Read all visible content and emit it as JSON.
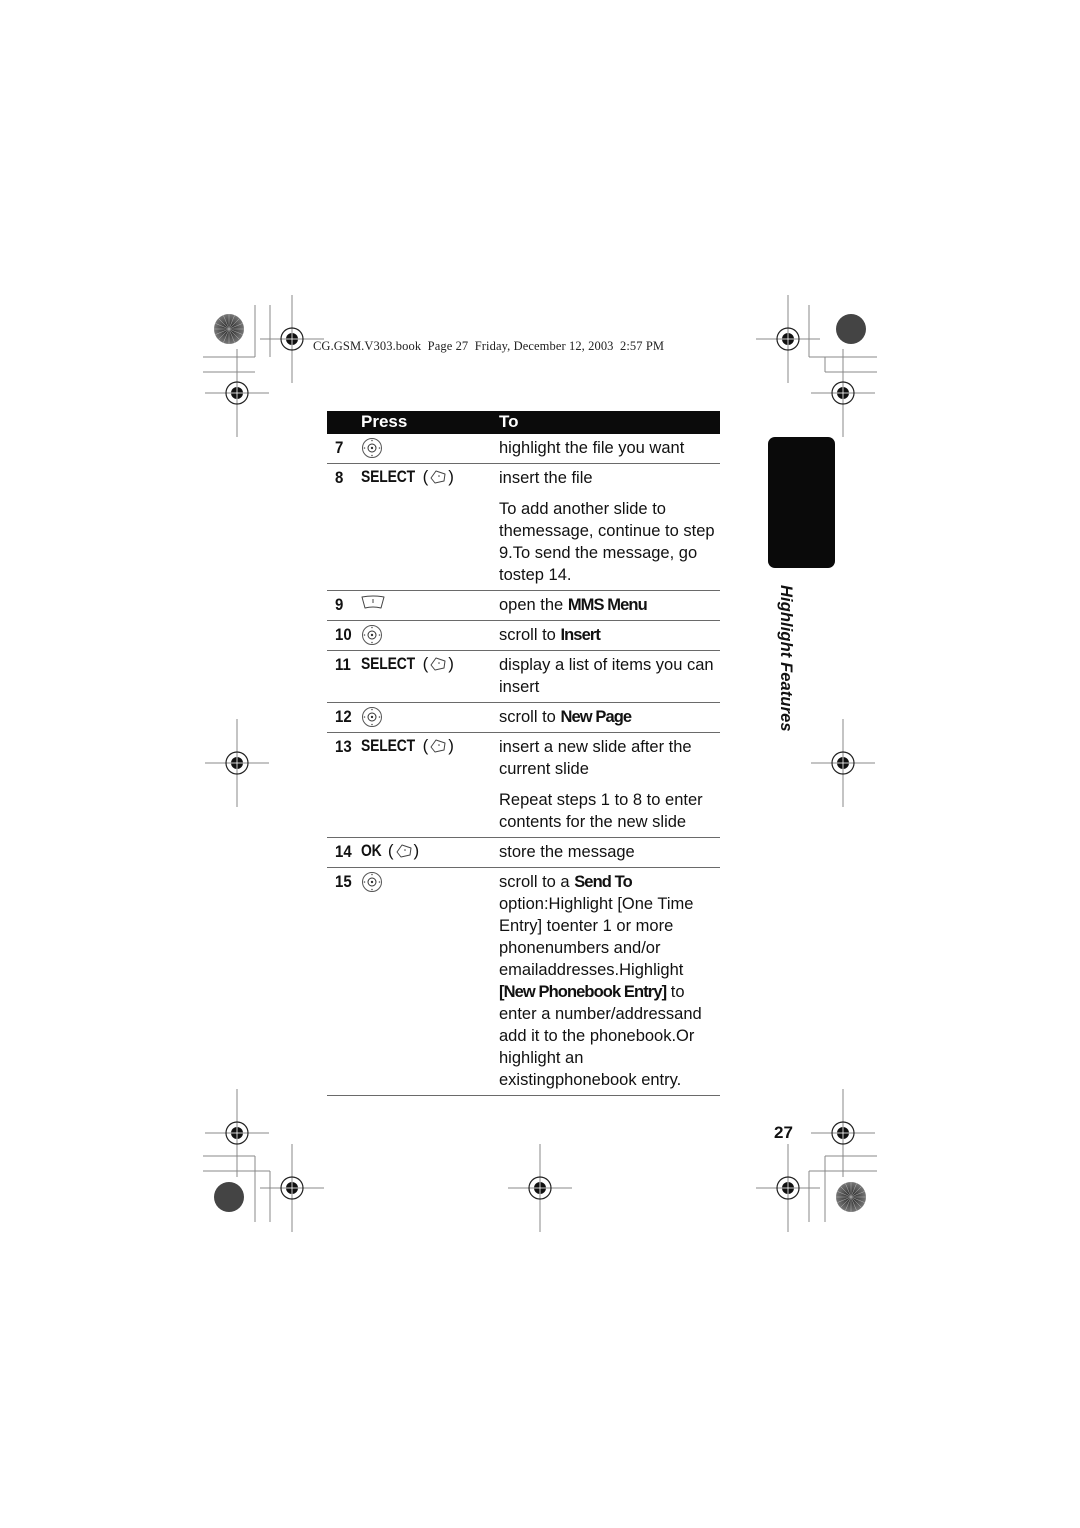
{
  "header": {
    "running_head": "CG.GSM.V303.book  Page 27  Friday, December 12, 2003  2:57 PM"
  },
  "table": {
    "columns": [
      "Press",
      "To"
    ],
    "rows": [
      {
        "step": "7",
        "press_label": "",
        "press_icon": "nav-key-icon",
        "to": [
          {
            "parts": [
              {
                "t": "highlight the file you want"
              }
            ]
          }
        ]
      },
      {
        "step": "8",
        "press_label": "SELECT",
        "press_icon": "right-soft-key-icon",
        "to": [
          {
            "parts": [
              {
                "t": "insert the file"
              }
            ]
          },
          {
            "parts": [
              {
                "t": "To add another slide to themessage, continue to step 9.To send the message, go tostep 14."
              }
            ]
          }
        ]
      },
      {
        "step": "9",
        "press_label": "",
        "press_icon": "menu-key-icon",
        "to": [
          {
            "parts": [
              {
                "t": "open the "
              },
              {
                "t": "MMS Menu",
                "kw": true
              }
            ]
          }
        ]
      },
      {
        "step": "10",
        "press_label": "",
        "press_icon": "nav-key-icon",
        "to": [
          {
            "parts": [
              {
                "t": "scroll to "
              },
              {
                "t": "Insert",
                "kw": true
              }
            ]
          }
        ]
      },
      {
        "step": "11",
        "press_label": "SELECT",
        "press_icon": "right-soft-key-icon",
        "to": [
          {
            "parts": [
              {
                "t": "display a list of items you can insert"
              }
            ]
          }
        ]
      },
      {
        "step": "12",
        "press_label": "",
        "press_icon": "nav-key-icon",
        "to": [
          {
            "parts": [
              {
                "t": "scroll to "
              },
              {
                "t": "New Page",
                "kw": true
              }
            ]
          }
        ]
      },
      {
        "step": "13",
        "press_label": "SELECT",
        "press_icon": "right-soft-key-icon",
        "to": [
          {
            "parts": [
              {
                "t": "insert a new slide after the current slide"
              }
            ]
          },
          {
            "parts": [
              {
                "t": "Repeat steps 1 to 8 to enter contents for the new slide"
              }
            ]
          }
        ]
      },
      {
        "step": "14",
        "press_label": "OK",
        "press_icon": "right-soft-key-icon",
        "to": [
          {
            "parts": [
              {
                "t": "store the message"
              }
            ]
          }
        ]
      },
      {
        "step": "15",
        "press_label": "",
        "press_icon": "nav-key-icon",
        "to": [
          {
            "parts": [
              {
                "t": "scroll to a "
              },
              {
                "t": "Send To",
                "kw": true
              },
              {
                "t": " option:Highlight [One Time Entry] toenter 1 or more phonenumbers and/or emailaddresses.Highlight "
              },
              {
                "t": "[New Phonebook Entry]",
                "kw": true
              },
              {
                "t": " to enter a number/addressand add it to the phonebook.Or highlight an existingphonebook entry."
              }
            ]
          }
        ]
      }
    ]
  },
  "side_tab": {
    "label": "Highlight Features"
  },
  "footer": {
    "page_number": "27"
  },
  "colors": {
    "header_bg": "#0b0b0b",
    "tab_bg": "#0a0a0a",
    "rule": "#6a6a6a"
  }
}
